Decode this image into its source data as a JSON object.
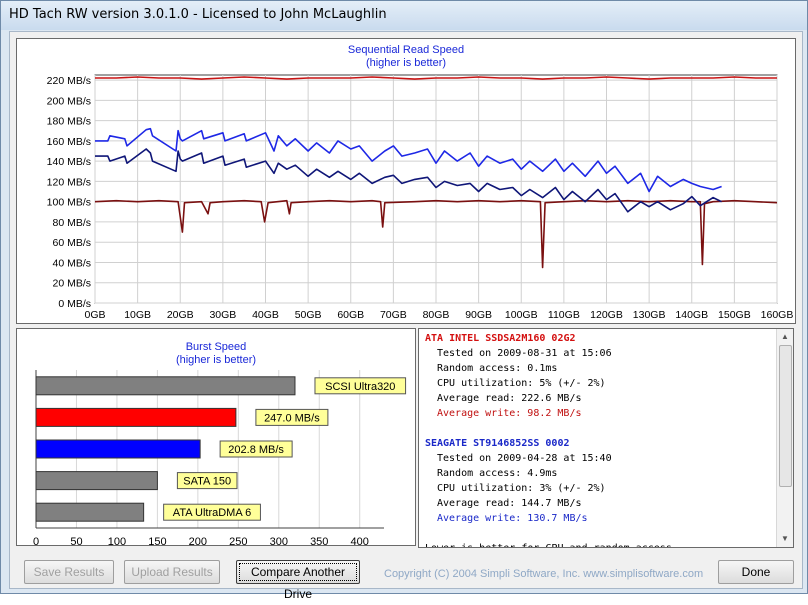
{
  "window": {
    "title": "HD Tach RW version 3.0.1.0 - Licensed to John McLaughlin"
  },
  "read_chart": {
    "title": "Sequential Read Speed",
    "subtitle": "(higher is better)"
  },
  "burst_chart": {
    "title": "Burst Speed",
    "subtitle": "(higher is better)"
  },
  "chart_data": [
    {
      "type": "line",
      "title": "Sequential Read Speed",
      "subtitle": "(higher is better)",
      "xlabel": "",
      "ylabel": "",
      "xlim": [
        0,
        160
      ],
      "ylim": [
        0,
        225
      ],
      "x_ticks": [
        "0GB",
        "10GB",
        "20GB",
        "30GB",
        "40GB",
        "50GB",
        "60GB",
        "70GB",
        "80GB",
        "90GB",
        "100GB",
        "110GB",
        "120GB",
        "130GB",
        "140GB",
        "150GB",
        "160GB"
      ],
      "y_ticks": [
        "0 MB/s",
        "20 MB/s",
        "40 MB/s",
        "60 MB/s",
        "80 MB/s",
        "100 MB/s",
        "120 MB/s",
        "140 MB/s",
        "160 MB/s",
        "180 MB/s",
        "200 MB/s",
        "220 MB/s"
      ],
      "grid": true,
      "series": [
        {
          "color": "#c81414",
          "x": [
            0,
            5,
            10,
            15,
            20,
            25,
            30,
            35,
            40,
            45,
            50,
            55,
            60,
            65,
            70,
            75,
            80,
            85,
            90,
            95,
            100,
            105,
            110,
            115,
            120,
            125,
            130,
            135,
            140,
            145,
            150,
            155,
            160
          ],
          "y": [
            222,
            222,
            223,
            222,
            222,
            221,
            222,
            223,
            222,
            221,
            222,
            222,
            222,
            223,
            222,
            221,
            222,
            222,
            223,
            222,
            222,
            221,
            222,
            222,
            223,
            222,
            221,
            222,
            222,
            222,
            223,
            222,
            222
          ]
        },
        {
          "color": "#7a1010",
          "x": [
            0,
            5,
            10,
            15,
            19.5,
            20.5,
            21,
            25,
            26.5,
            27,
            30,
            35,
            39,
            39.8,
            40.6,
            45,
            45.6,
            46,
            50,
            55,
            60,
            65,
            67,
            67.5,
            68,
            75,
            80,
            85,
            90,
            95,
            100,
            104.5,
            105,
            105.6,
            110,
            115,
            120,
            125,
            130,
            135,
            140,
            142,
            142.5,
            143,
            145,
            150,
            155,
            160
          ],
          "y": [
            100,
            101,
            100,
            101,
            100,
            70,
            99,
            100,
            88,
            99,
            100,
            101,
            100,
            80,
            99,
            101,
            88,
            99,
            100,
            101,
            100,
            101,
            100,
            75,
            99,
            100,
            101,
            100,
            101,
            100,
            101,
            100,
            35,
            99,
            100,
            101,
            100,
            101,
            100,
            101,
            100,
            100,
            38,
            98,
            100,
            101,
            100,
            99
          ]
        },
        {
          "color": "#1e28e6",
          "x": [
            0,
            3,
            3.5,
            7,
            7.5,
            12,
            13,
            13.5,
            19,
            19.5,
            20,
            20.5,
            25,
            25.5,
            30,
            30.5,
            35,
            35.5,
            40,
            42,
            43,
            45,
            47,
            50,
            52,
            55,
            57,
            60,
            62,
            65,
            68,
            70,
            72,
            75,
            78,
            80,
            82,
            85,
            88,
            90,
            92,
            95,
            98,
            100,
            102,
            105,
            108,
            110,
            112,
            115,
            118,
            120,
            122,
            125,
            128,
            130,
            132,
            135,
            138,
            140,
            142,
            145,
            147
          ],
          "y": [
            160,
            160,
            165,
            162,
            155,
            171,
            172,
            165,
            150,
            170,
            162,
            160,
            170,
            162,
            168,
            160,
            167,
            160,
            168,
            150,
            165,
            155,
            162,
            150,
            158,
            148,
            160,
            152,
            155,
            140,
            150,
            155,
            145,
            148,
            152,
            138,
            150,
            140,
            148,
            135,
            145,
            138,
            142,
            132,
            140,
            130,
            142,
            130,
            138,
            125,
            140,
            128,
            135,
            118,
            128,
            110,
            125,
            115,
            122,
            118,
            115,
            112,
            115
          ]
        },
        {
          "color": "#0f1678",
          "x": [
            0,
            3,
            3.5,
            7,
            7.5,
            12,
            13,
            13.5,
            19,
            19.5,
            20,
            20.5,
            25,
            25.5,
            30,
            30.5,
            35,
            35.5,
            40,
            42,
            43,
            45,
            47,
            50,
            52,
            55,
            57,
            60,
            62,
            65,
            68,
            70,
            72,
            75,
            78,
            80,
            82,
            85,
            88,
            90,
            92,
            95,
            98,
            100,
            102,
            105,
            108,
            110,
            112,
            115,
            118,
            120,
            122,
            125,
            128,
            130,
            132,
            135,
            138,
            140,
            142,
            145,
            147
          ],
          "y": [
            145,
            145,
            140,
            145,
            138,
            152,
            148,
            140,
            130,
            150,
            142,
            140,
            148,
            138,
            145,
            136,
            142,
            134,
            140,
            128,
            138,
            132,
            136,
            125,
            132,
            124,
            130,
            122,
            128,
            118,
            124,
            126,
            118,
            122,
            124,
            114,
            120,
            116,
            118,
            110,
            118,
            112,
            114,
            106,
            112,
            104,
            114,
            102,
            110,
            100,
            112,
            102,
            108,
            90,
            100,
            95,
            100,
            92,
            98,
            105,
            96,
            104,
            100
          ]
        }
      ]
    },
    {
      "type": "bar",
      "orientation": "horizontal",
      "title": "Burst Speed",
      "subtitle": "(higher is better)",
      "xlim": [
        0,
        430
      ],
      "x_ticks": [
        "0",
        "50",
        "100",
        "150",
        "200",
        "250",
        "300",
        "350",
        "400"
      ],
      "grid": true,
      "categories": [
        "SCSI Ultra320",
        "247.0 MB/s",
        "202.8 MB/s",
        "SATA 150",
        "ATA UltraDMA 6"
      ],
      "values": [
        320,
        247,
        202.8,
        150,
        133
      ],
      "bar_colors": [
        "#808080",
        "#ff0000",
        "#0000ff",
        "#808080",
        "#808080"
      ]
    }
  ],
  "results": [
    {
      "title": "ATA INTEL SSDSA2M160 02G2",
      "title_color": "#d41010",
      "lines": [
        {
          "text": "Tested on 2009-08-31 at 15:06",
          "color": "#000000"
        },
        {
          "text": "Random access: 0.1ms",
          "color": "#000000"
        },
        {
          "text": "CPU utilization: 5% (+/- 2%)",
          "color": "#000000"
        },
        {
          "text": "Average read: 222.6 MB/s",
          "color": "#000000"
        },
        {
          "text": "Average write: 98.2 MB/s",
          "color": "#c01010"
        }
      ]
    },
    {
      "title": "SEAGATE ST9146852SS 0002",
      "title_color": "#1a28c8",
      "lines": [
        {
          "text": "Tested on 2009-04-28 at 15:40",
          "color": "#000000"
        },
        {
          "text": "Random access: 4.9ms",
          "color": "#000000"
        },
        {
          "text": "CPU utilization: 3% (+/- 2%)",
          "color": "#000000"
        },
        {
          "text": "Average read: 144.7 MB/s",
          "color": "#000000"
        },
        {
          "text": "Average write: 130.7 MB/s",
          "color": "#1a28c8"
        }
      ]
    }
  ],
  "results_footer": "Lower is better for CPU and random access.",
  "buttons": {
    "save": "Save Results",
    "upload": "Upload Results",
    "compare": "Compare Another Drive",
    "done": "Done"
  },
  "copyright": "Copyright (C) 2004 Simpli Software, Inc. www.simplisoftware.com"
}
